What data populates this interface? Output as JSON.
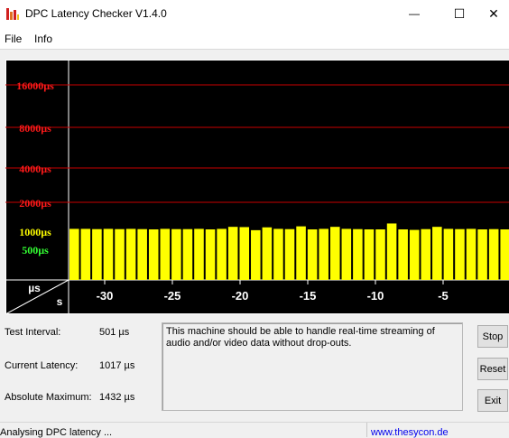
{
  "window": {
    "title": "DPC Latency Checker V1.4.0",
    "icon": "bar-chart-app-icon",
    "controls": {
      "minimize": "—",
      "maximize": "☐",
      "close": "✕"
    }
  },
  "menu": {
    "items": [
      "File",
      "Info"
    ]
  },
  "chart_data": {
    "type": "bar",
    "background": "#000000",
    "grid_color": "#c80000",
    "bar_color": "#ffff00",
    "y_axis_labels": [
      {
        "text": "16000µs",
        "color": "#ff1a1a"
      },
      {
        "text": "8000µs",
        "color": "#ff1a1a"
      },
      {
        "text": "4000µs",
        "color": "#ff1a1a"
      },
      {
        "text": "2000µs",
        "color": "#ff1a1a"
      },
      {
        "text": "1000µs",
        "color": "#ffff00"
      },
      {
        "text": "500µs",
        "color": "#33ff33"
      }
    ],
    "y_unit": "µs",
    "x_unit": "s",
    "x_ticks": [
      "-30",
      "-25",
      "-20",
      "-15",
      "-10",
      "-5"
    ],
    "values": [
      1010,
      1010,
      1005,
      1010,
      1005,
      1010,
      1005,
      1000,
      1010,
      1005,
      1005,
      1010,
      1000,
      1010,
      1050,
      1045,
      985,
      1040,
      1010,
      1005,
      1060,
      1000,
      1010,
      1050,
      1010,
      1005,
      1000,
      1000,
      1120,
      1000,
      990,
      1005,
      1050,
      1010,
      1005,
      1010,
      1000,
      1005,
      1000
    ]
  },
  "stats": {
    "test_interval_label": "Test Interval:",
    "test_interval_value": "501 µs",
    "current_latency_label": "Current Latency:",
    "current_latency_value": "1017 µs",
    "absolute_max_label": "Absolute Maximum:",
    "absolute_max_value": "1432 µs"
  },
  "message": "This machine should be able to handle real-time streaming of audio and/or video data without drop-outs.",
  "buttons": {
    "stop": "Stop",
    "reset": "Reset",
    "exit": "Exit"
  },
  "status": {
    "text": "Analysing DPC latency ...",
    "link": "www.thesycon.de"
  }
}
